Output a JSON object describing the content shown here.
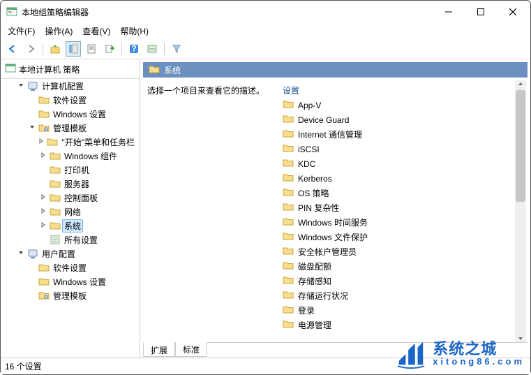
{
  "window": {
    "title": "本地组策略编辑器"
  },
  "menu": {
    "file": "文件(F)",
    "action": "操作(A)",
    "view": "查看(V)",
    "help": "帮助(H)"
  },
  "tree": {
    "root": "本地计算机 策略",
    "computer": "计算机配置",
    "c_soft": "软件设置",
    "c_win": "Windows 设置",
    "c_adm": "管理模板",
    "c_start": "\"开始\"菜单和任务栏",
    "c_wincomp": "Windows 组件",
    "c_printer": "打印机",
    "c_server": "服务器",
    "c_ctrl": "控制面板",
    "c_net": "网络",
    "c_sys": "系统",
    "c_all": "所有设置",
    "user": "用户配置",
    "u_soft": "软件设置",
    "u_win": "Windows 设置",
    "u_adm": "管理模板"
  },
  "right": {
    "header": "系统",
    "desc": "选择一个项目来查看它的描述。",
    "items": [
      "设置",
      "App-V",
      "Device Guard",
      "Internet 通信管理",
      "iSCSI",
      "KDC",
      "Kerberos",
      "OS 策略",
      "PIN 复杂性",
      "Windows 时间服务",
      "Windows 文件保护",
      "安全帐户管理员",
      "磁盘配额",
      "存储感知",
      "存储运行状况",
      "登录",
      "电源管理"
    ]
  },
  "tabs": {
    "ext": "扩展",
    "std": "标准"
  },
  "status": "16 个设置",
  "watermark": {
    "line1": "系统之城",
    "line2": "xitong86.com"
  }
}
